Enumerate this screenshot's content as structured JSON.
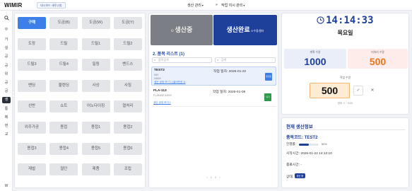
{
  "header": {
    "logo": "WIMIR",
    "top_button": "대시보드 새로고침",
    "menu1": "생산 관리",
    "menu2": "작업 지시 관리"
  },
  "sidebar": {
    "items": [
      "가",
      "실",
      "공",
      "공",
      "위",
      "공",
      "공",
      "생",
      "통",
      "메",
      "현",
      "교"
    ],
    "active_index": 7,
    "bottom_label": "W"
  },
  "categories": [
    "구매",
    "도금(B)",
    "도금(W)",
    "도금(Y)",
    "도장",
    "드릴",
    "드릴1",
    "드릴2",
    "드릴3",
    "드릴4",
    "밀링",
    "벤드스",
    "벤딩",
    "불렌딩",
    "사상",
    "사침",
    "선반",
    "쇼트",
    "어노다이징",
    "열처리",
    "외주가공",
    "용접",
    "용접1",
    "용접2",
    "용접3",
    "용접4",
    "용접5",
    "용접6",
    "재벌",
    "절단",
    "제품",
    "조립"
  ],
  "actions": {
    "start_label": "생산중",
    "start_icon": "play-icon",
    "complete_label": "생산완료",
    "complete_sub": "수정/필터",
    "complete_icon": "check-icon"
  },
  "list": {
    "title": "2. 품목 리스트 (1)",
    "search1_placeholder": "품목검색",
    "search2_placeholder": "검색",
    "items": [
      {
        "code": "TEST2",
        "date": "작업 일자: 2026-01-22",
        "sub1": "660",
        "sub2": "NAB2",
        "note": "생산 공정 보기 1 (설비번호 1)",
        "status": "생산중",
        "status_color": "#3d7fe8",
        "selected": true
      },
      {
        "code": "FLA-113",
        "date": "작업 일자: 2026-01-09",
        "sub1": "FLANGE ASSY",
        "sub2": "",
        "note": "생산 공정 보기 1",
        "status": "대기",
        "status_color": "#2c9a48",
        "selected": false
      }
    ],
    "pager": [
      "‹",
      "1",
      "2",
      "›"
    ]
  },
  "clock": {
    "time": "14:14:33",
    "day": "목요일",
    "icon": "clock-icon"
  },
  "quantities": {
    "plan_label": "계획 수량",
    "plan_value": "1000",
    "remain_label": "미처리 수량",
    "remain_value": "500",
    "work_label": "작업 수량",
    "work_value": "500",
    "work_hint": "범위: 0 ~ 1000",
    "confirm_icon": "check-icon",
    "clear_icon": "close-icon"
  },
  "production": {
    "title": "현재 생산정보",
    "item_code_label": "품목코드:",
    "item_code": "TEST2",
    "progress_label": "진행률:",
    "progress_value": 0.5,
    "progress_text": "50%",
    "start_label": "시작시간:",
    "start_time": "2026-01-22 14:13:10",
    "end_label": "종료시간:",
    "end_time": "-",
    "state_label": "상태:",
    "state_value": "생산 중"
  },
  "colors": {
    "accent": "#3d7fe8",
    "navy": "#1e3f9a",
    "orange": "#e8751a",
    "green": "#2c9a48"
  }
}
